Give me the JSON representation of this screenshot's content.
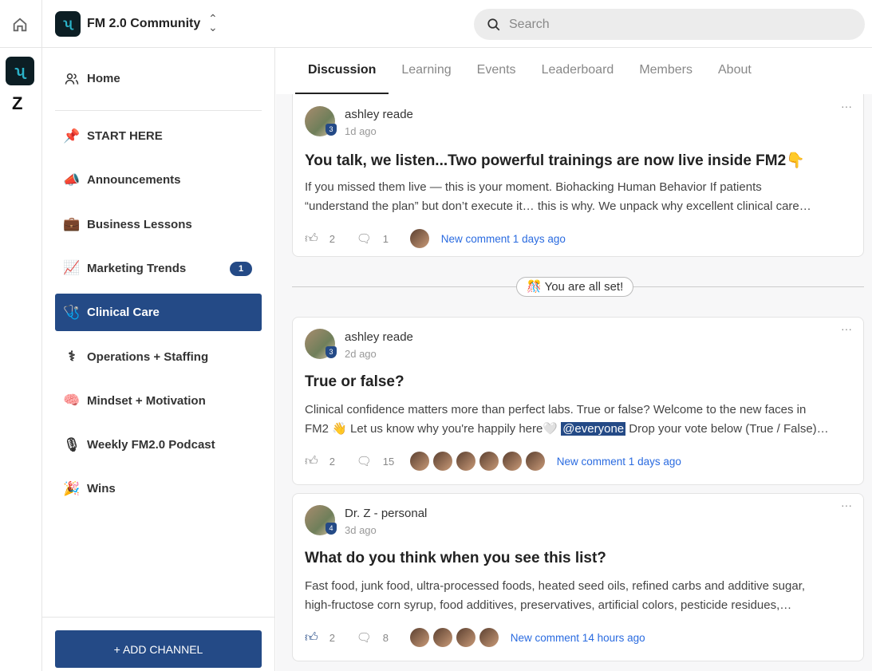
{
  "rail": {
    "z_logo": "Z"
  },
  "header": {
    "community": "FM 2.0 Community",
    "search_placeholder": "Search"
  },
  "sidebar": {
    "home": "Home",
    "items": [
      {
        "label": "START HERE",
        "icon": "📌"
      },
      {
        "label": "Announcements",
        "icon": "📣"
      },
      {
        "label": "Business Lessons",
        "icon": "💼"
      },
      {
        "label": "Marketing Trends",
        "icon": "📈",
        "badge": "1"
      },
      {
        "label": "Clinical Care",
        "icon": "🩺",
        "active": true
      },
      {
        "label": "Operations + Staffing",
        "icon": "⚕"
      },
      {
        "label": "Mindset + Motivation",
        "icon": "🧠"
      },
      {
        "label": "Weekly FM2.0 Podcast",
        "icon": "🎙"
      },
      {
        "label": "Wins",
        "icon": "🎉"
      }
    ],
    "add_channel": "+ ADD CHANNEL"
  },
  "tabs": [
    "Discussion",
    "Learning",
    "Events",
    "Leaderboard",
    "Members",
    "About"
  ],
  "divider": "🎊 You are all set!",
  "posts": [
    {
      "author": "ashley reade",
      "level": "3",
      "time": "1d ago",
      "title": "You talk, we listen...Two powerful trainings are now live inside FM2👇",
      "body": [
        "If you missed them live — this is your moment. Biohacking Human Behavior If patients",
        "“understand the plan” but don’t execute it… this is why. We unpack why excellent clinical care…"
      ],
      "likes": "2",
      "comments": "1",
      "faces": 1,
      "new_comment": "New comment 1 days ago"
    },
    {
      "author": "ashley reade",
      "level": "3",
      "time": "2d ago",
      "title": "True or false?",
      "body": [
        "Clinical confidence matters more than perfect labs. True or false? Welcome to the new faces in",
        "FM2 👋 Let us know why you're happily here🤍 "
      ],
      "mention": "@everyone",
      "body_tail": " Drop your vote below (True / False)…",
      "likes": "2",
      "comments": "15",
      "faces": 6,
      "new_comment": "New comment 1 days ago"
    },
    {
      "author": "Dr. Z - personal",
      "level": "4",
      "time": "3d ago",
      "title": "What do you think when you see this list?",
      "body": [
        "Fast food, junk food, ultra-processed foods, heated seed oils, refined carbs and additive sugar,",
        "high-fructose corn syrup, food additives, preservatives, artificial colors, pesticide residues,…"
      ],
      "likes": "2",
      "comments": "8",
      "faces": 4,
      "new_comment": "New comment 14 hours ago",
      "liked": true
    }
  ]
}
